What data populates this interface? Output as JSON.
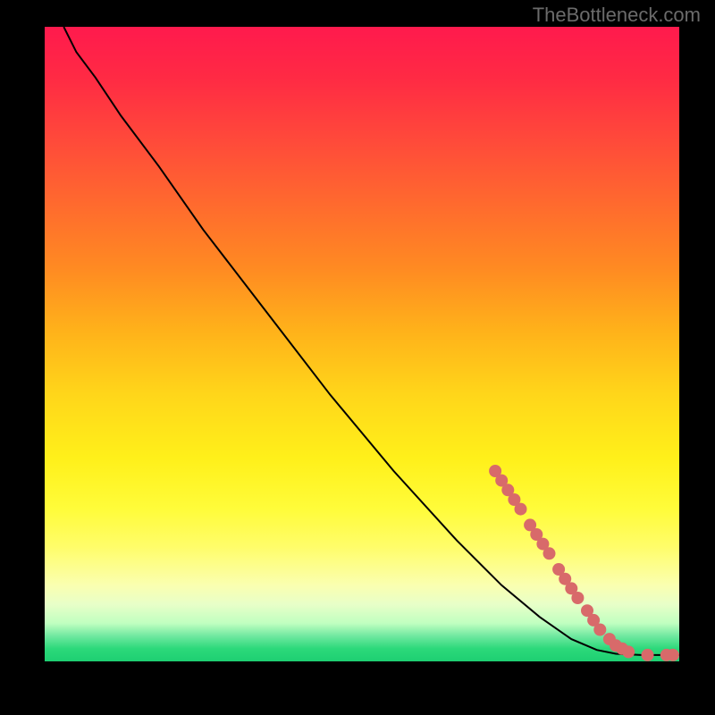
{
  "watermark": "TheBottleneck.com",
  "chart_data": {
    "type": "line",
    "title": "",
    "xlabel": "",
    "ylabel": "",
    "xlim": [
      0,
      100
    ],
    "ylim": [
      0,
      100
    ],
    "curve": [
      {
        "x": 3,
        "y": 100
      },
      {
        "x": 5,
        "y": 96
      },
      {
        "x": 8,
        "y": 92
      },
      {
        "x": 12,
        "y": 86
      },
      {
        "x": 18,
        "y": 78
      },
      {
        "x": 25,
        "y": 68
      },
      {
        "x": 35,
        "y": 55
      },
      {
        "x": 45,
        "y": 42
      },
      {
        "x": 55,
        "y": 30
      },
      {
        "x": 65,
        "y": 19
      },
      {
        "x": 72,
        "y": 12
      },
      {
        "x": 78,
        "y": 7
      },
      {
        "x": 83,
        "y": 3.5
      },
      {
        "x": 87,
        "y": 1.8
      },
      {
        "x": 90,
        "y": 1.2
      },
      {
        "x": 94,
        "y": 1.0
      },
      {
        "x": 98,
        "y": 1.0
      },
      {
        "x": 100,
        "y": 1.0
      }
    ],
    "series": [
      {
        "name": "highlighted-points",
        "color": "#d86a6a",
        "points": [
          {
            "x": 71,
            "y": 30
          },
          {
            "x": 72,
            "y": 28.5
          },
          {
            "x": 73,
            "y": 27
          },
          {
            "x": 74,
            "y": 25.5
          },
          {
            "x": 75,
            "y": 24
          },
          {
            "x": 76.5,
            "y": 21.5
          },
          {
            "x": 77.5,
            "y": 20
          },
          {
            "x": 78.5,
            "y": 18.5
          },
          {
            "x": 79.5,
            "y": 17
          },
          {
            "x": 81,
            "y": 14.5
          },
          {
            "x": 82,
            "y": 13
          },
          {
            "x": 83,
            "y": 11.5
          },
          {
            "x": 84,
            "y": 10
          },
          {
            "x": 85.5,
            "y": 8
          },
          {
            "x": 86.5,
            "y": 6.5
          },
          {
            "x": 87.5,
            "y": 5
          },
          {
            "x": 89,
            "y": 3.5
          },
          {
            "x": 90,
            "y": 2.5
          },
          {
            "x": 91,
            "y": 2
          },
          {
            "x": 92,
            "y": 1.5
          },
          {
            "x": 95,
            "y": 1.0
          },
          {
            "x": 98,
            "y": 1.0
          },
          {
            "x": 99,
            "y": 1.0
          }
        ]
      }
    ]
  }
}
